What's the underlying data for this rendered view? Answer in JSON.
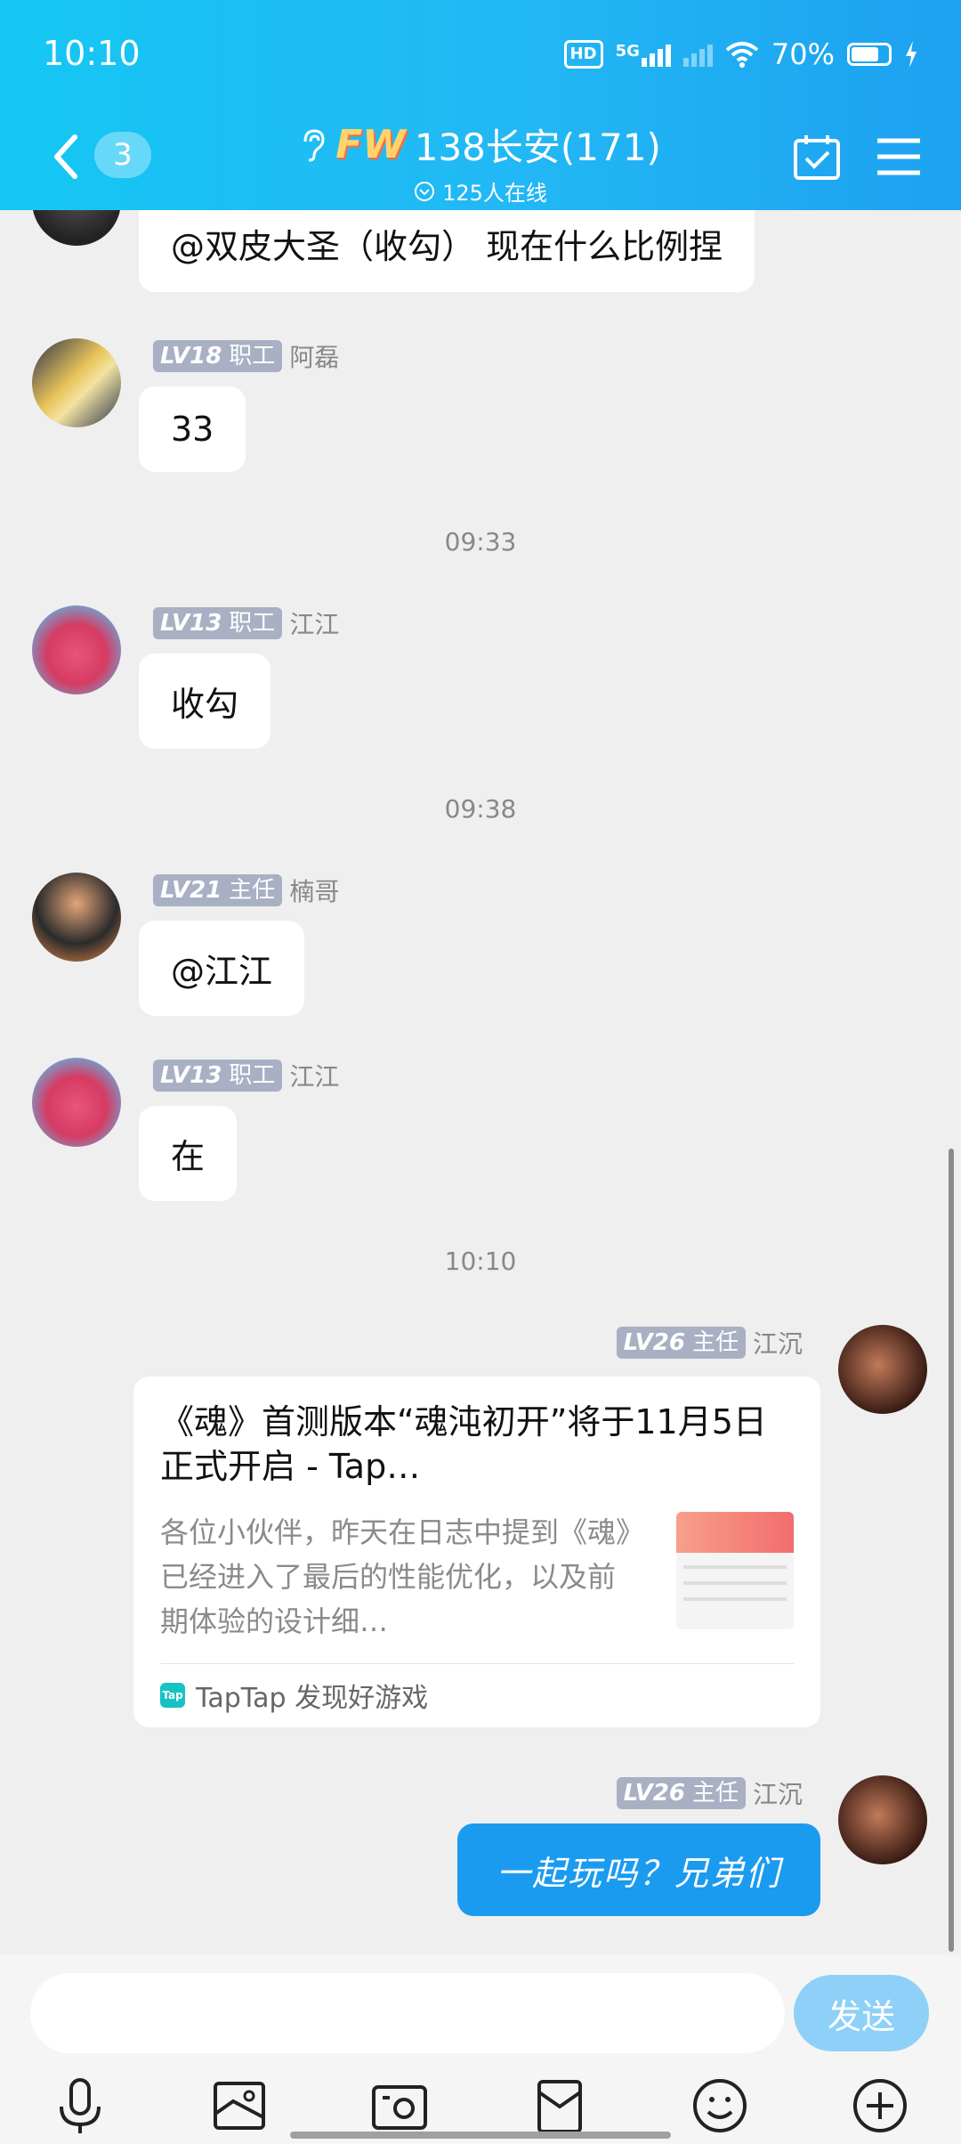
{
  "status_bar": {
    "time": "10:10",
    "hd": "HD",
    "net": "5G",
    "battery": "70%"
  },
  "header": {
    "back_count": "3",
    "title_logo": "FW",
    "title": "138长安(171)",
    "online": "125人在线"
  },
  "messages": [
    {
      "text": "@双皮大圣（收勾） 现在什么比例捏"
    },
    {
      "level": "LV18",
      "role": "职工",
      "name": "阿磊",
      "text": "33"
    },
    {
      "timestamp": "09:33"
    },
    {
      "level": "LV13",
      "role": "职工",
      "name": "江江",
      "text": "收勾"
    },
    {
      "timestamp": "09:38"
    },
    {
      "level": "LV21",
      "role": "主任",
      "name": "楠哥",
      "text": "@江江"
    },
    {
      "level": "LV13",
      "role": "职工",
      "name": "江江",
      "text": "在"
    },
    {
      "timestamp": "10:10"
    },
    {
      "level": "LV26",
      "role": "主任",
      "name": "江沉"
    },
    {
      "level": "LV26",
      "role": "主任",
      "name": "江沉",
      "text": "一起玩吗？兄弟们"
    }
  ],
  "link_card": {
    "title": "《魂》首测版本“魂沌初开”将于11月5日正式开启 - Tap…",
    "description": "各位小伙伴，昨天在日志中提到《魂》已经进入了最后的性能优化，以及前期体验的设计细…",
    "source_logo": "Tap",
    "source": "TapTap 发现好游戏"
  },
  "input": {
    "placeholder": "",
    "send_label": "发送"
  },
  "colors": {
    "header": "#1fb6f4",
    "accent": "#1a9bf0",
    "level_badge": "#a9b0c3"
  }
}
